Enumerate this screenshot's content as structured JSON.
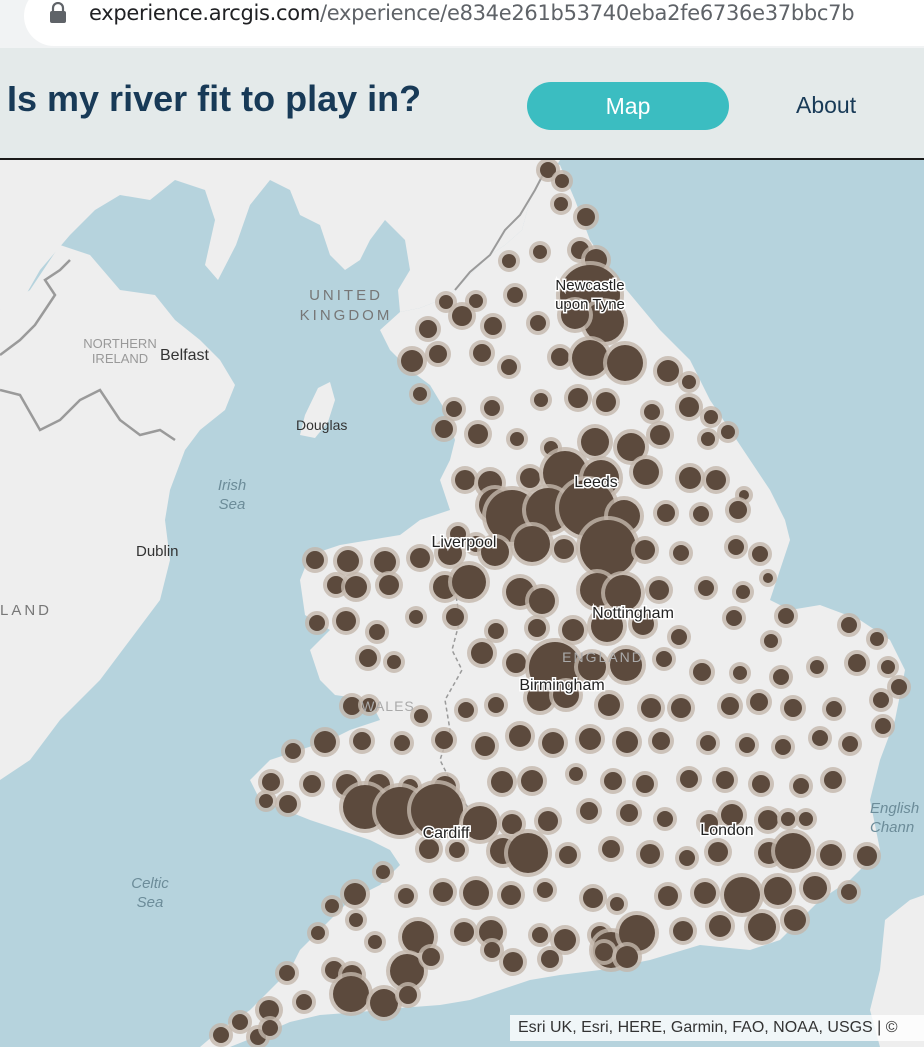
{
  "browser": {
    "url_host": "experience.arcgis.com",
    "url_path": "/experience/e834e261b53740eba2fe6736e37bbc7b"
  },
  "header": {
    "title": "Is my river fit to play in?",
    "nav": {
      "map": "Map",
      "about": "About"
    }
  },
  "map": {
    "labels": {
      "united_kingdom": "UNITED KINGDOM",
      "northern_ireland": "NORTHERN IRELAND",
      "belfast": "Belfast",
      "douglas": "Douglas",
      "irish_sea": "Irish Sea",
      "dublin": "Dublin",
      "ireland_partial": "LAND",
      "newcastle": "Newcastle upon Tyne",
      "leeds": "Leeds",
      "liverpool": "Liverpool",
      "nottingham": "Nottingham",
      "england": "ENGLAND",
      "birmingham": "Birmingham",
      "wales": "WALES",
      "cardiff": "Cardiff",
      "london": "London",
      "celtic_sea": "Celtic Sea",
      "english_channel": "English Chann"
    },
    "attribution": "Esri UK, Esri, HERE, Garmin, FAO, NOAA, USGS | ©",
    "colors": {
      "water": "#b6d3dd",
      "land": "#eeeeee",
      "border": "#9a9a9a",
      "cluster_fill": "#5c4a3d",
      "cluster_halo": "#c3b7ab",
      "accent": "#3bbdc1",
      "title": "#183a57"
    }
  }
}
